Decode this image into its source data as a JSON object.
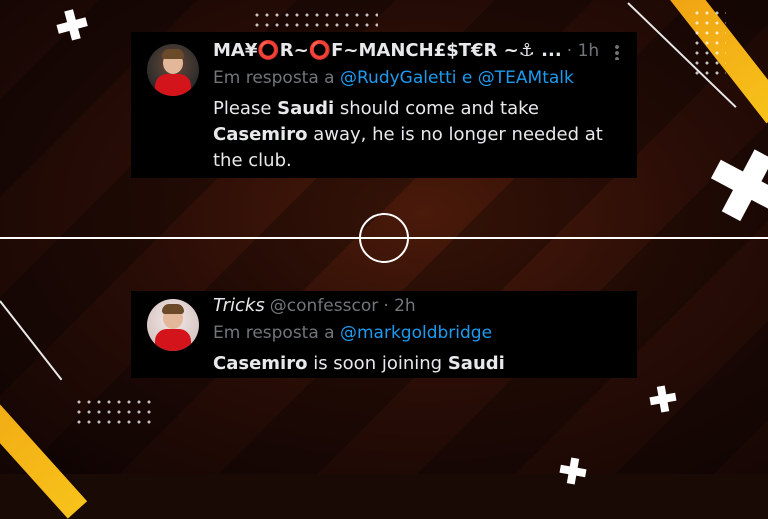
{
  "tweet1": {
    "name": "MA¥⭕R~⭕F~MANCH£$T€R ~⚓ ...",
    "time": "· 1h",
    "reply_prefix": "Em resposta a",
    "mention1": "@RudyGaletti",
    "conj": "e",
    "mention2": "@TEAMtalk",
    "text_1": "Please",
    "bold_1": "Saudi",
    "text_2": "should come and take",
    "bold_2": "Casemiro",
    "text_3": "away, he is no longer needed at",
    "text_4": "the club."
  },
  "tweet2": {
    "name": "Tricks",
    "handle": "@confesscor",
    "time": "· 2h",
    "reply_prefix": "Em resposta a",
    "mention1": "@markgoldbridge",
    "bold_1": "Casemiro",
    "text_1": "is soon joining",
    "bold_2": "Saudi"
  },
  "colors": {
    "link": "#1d9bf0",
    "muted": "#71767b",
    "accent_yellow": "#f7c21a",
    "tweet_bg": "#000000"
  },
  "icons": [
    "more-options-icon",
    "anchor-icon",
    "plus-cross-icon"
  ]
}
